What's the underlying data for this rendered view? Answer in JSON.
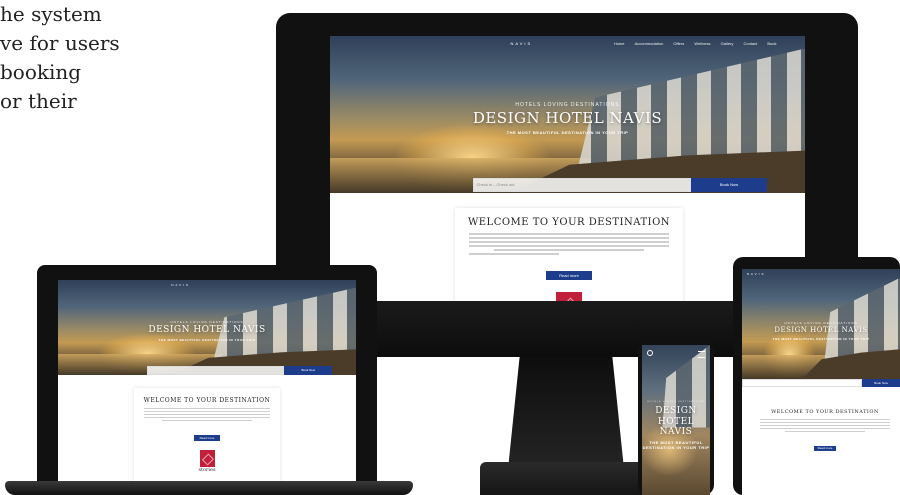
{
  "intro_lines": [
    "he system",
    "ve for users",
    "booking",
    "or their"
  ],
  "site": {
    "logo": "NAVIS",
    "nav": [
      "Home",
      "Accommodation",
      "Offers",
      "Wellness",
      "Gallery",
      "Contact",
      "Book"
    ],
    "kicker": "HOTELS LOVING DESTINATIONS",
    "title": "DESIGN HOTEL NAVIS",
    "title_mobile_1": "DESIGN",
    "title_mobile_2": "HOTEL NAVIS",
    "subtitle": "THE MOST BEAUTIFUL DESTINATION IN YOUR TRIP",
    "subtitle_mobile_1": "THE MOST BEAUTIFUL",
    "subtitle_mobile_2": "DESTINATION IN YOUR TRIP",
    "booking_placeholder": "Check in – Check out",
    "booking_button": "Book Now",
    "welcome_title": "WELCOME TO YOUR DESTINATION",
    "read_more": "Read more",
    "stories": "stories"
  },
  "colors": {
    "brand_blue": "#1d3c8c",
    "stories_red": "#c2203a",
    "device_black": "#111111"
  }
}
